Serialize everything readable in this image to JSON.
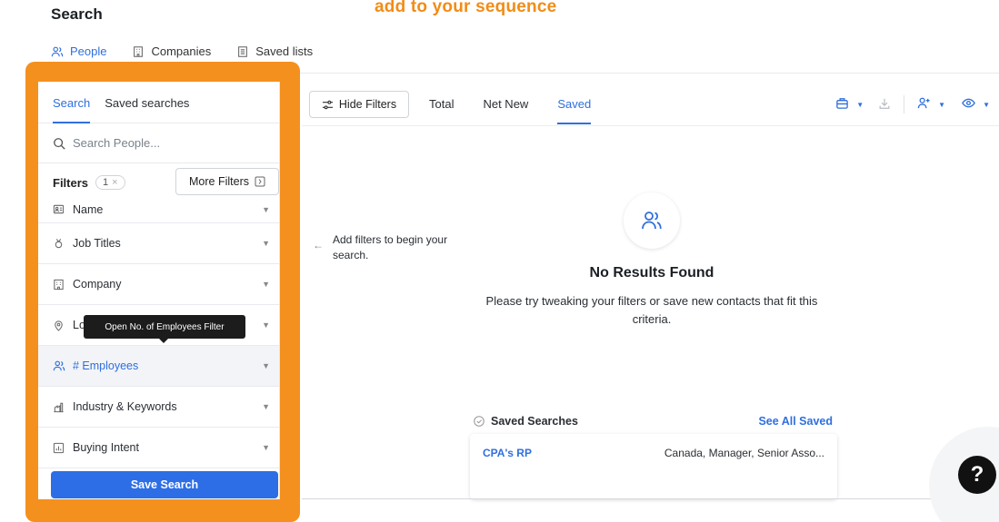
{
  "header": {
    "title": "Search",
    "overlay_caption": "add to your sequence"
  },
  "top_tabs": [
    {
      "label": "People",
      "icon": "people-icon",
      "active": true
    },
    {
      "label": "Companies",
      "icon": "building-icon",
      "active": false
    },
    {
      "label": "Saved lists",
      "icon": "list-icon",
      "active": false
    }
  ],
  "sidebar": {
    "tabs": [
      {
        "label": "Search",
        "active": true
      },
      {
        "label": "Saved searches",
        "active": false
      }
    ],
    "search_placeholder": "Search People...",
    "filters_label": "Filters",
    "filter_count": "1",
    "more_filters_label": "More Filters",
    "filters": [
      {
        "label": "Name",
        "icon": "id-card-icon"
      },
      {
        "label": "Job Titles",
        "icon": "badge-icon"
      },
      {
        "label": "Company",
        "icon": "building-icon"
      },
      {
        "label": "Lo",
        "icon": "location-pin-icon"
      },
      {
        "label": "# Employees",
        "icon": "people-icon",
        "active": true
      },
      {
        "label": "Industry & Keywords",
        "icon": "industry-icon"
      },
      {
        "label": "Buying Intent",
        "icon": "chart-icon"
      }
    ],
    "tooltip": "Open No. of Employees Filter",
    "save_search_label": "Save Search"
  },
  "toolbar": {
    "hide_filters_label": "Hide Filters",
    "view_tabs": [
      {
        "label": "Total",
        "active": false
      },
      {
        "label": "Net New",
        "active": false
      },
      {
        "label": "Saved",
        "active": true
      }
    ]
  },
  "main": {
    "hint": "Add filters to begin your search.",
    "empty_title": "No Results Found",
    "empty_description": "Please try tweaking your filters or save new contacts that fit this criteria.",
    "saved_searches_label": "Saved Searches",
    "see_all_label": "See All Saved",
    "saved_items": [
      {
        "name": "CPA's RP",
        "summary": "Canada, Manager, Senior Asso..."
      }
    ]
  },
  "help_label": "?",
  "colors": {
    "accent": "#2f6fde",
    "highlight": "#f4901e",
    "caption": "#f28c16",
    "primary_button": "#2d6ee6"
  }
}
